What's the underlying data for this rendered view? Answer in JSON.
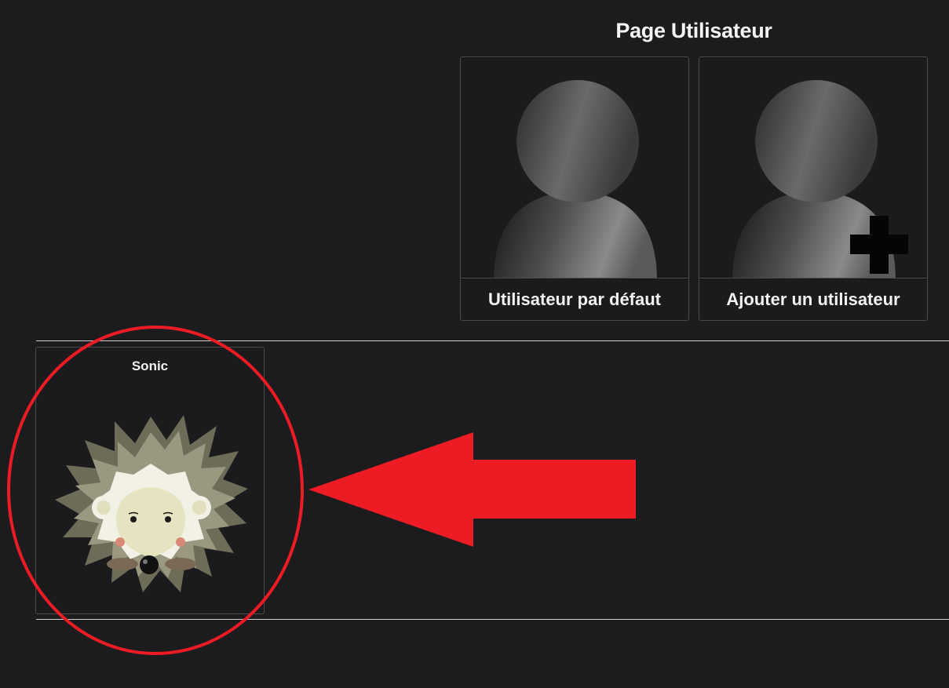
{
  "page": {
    "title": "Page Utilisateur"
  },
  "user_options": [
    {
      "label": "Utilisateur par défaut",
      "icon": "user-silhouette-icon"
    },
    {
      "label": "Ajouter un utilisateur",
      "icon": "user-add-icon"
    }
  ],
  "profiles": [
    {
      "name": "Sonic",
      "avatar": "hedgehog-avatar"
    }
  ],
  "colors": {
    "background": "#1c1c1e",
    "card_border": "#4a4a4d",
    "annotation_red": "#ed1c24",
    "text": "#f2f2f2"
  }
}
